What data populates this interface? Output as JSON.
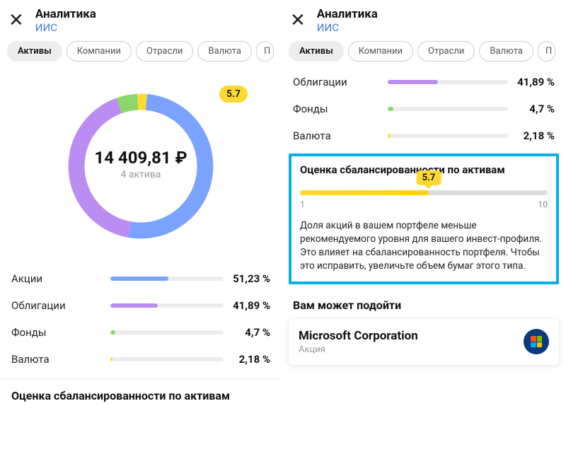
{
  "header": {
    "title": "Аналитика",
    "subtitle": "ИИС"
  },
  "tabs": [
    "Активы",
    "Компании",
    "Отрасли",
    "Валюта",
    "П"
  ],
  "active_tab": "Активы",
  "badge_score": "5.7",
  "amount": "14 409,81 ₽",
  "assets_count_label": "4 актива",
  "assets": [
    {
      "name": "Акции",
      "pct_label": "51,23 %",
      "pct": 51.23,
      "color": "#7aa2ff"
    },
    {
      "name": "Облигации",
      "pct_label": "41,89 %",
      "pct": 41.89,
      "color": "#bb8cf2"
    },
    {
      "name": "Фонды",
      "pct_label": "4,7 %",
      "pct": 4.7,
      "color": "#8ed66b"
    },
    {
      "name": "Валюта",
      "pct_label": "2,18 %",
      "pct": 2.18,
      "color": "#ffd92f"
    }
  ],
  "right_assets": [
    {
      "name": "Облигации",
      "pct_label": "41,89 %",
      "pct": 41.89,
      "color": "#bb8cf2"
    },
    {
      "name": "Фонды",
      "pct_label": "4,7 %",
      "pct": 4.7,
      "color": "#8ed66b"
    },
    {
      "name": "Валюта",
      "pct_label": "2,18 %",
      "pct": 2.18,
      "color": "#ffd92f"
    }
  ],
  "balance": {
    "section_title": "Оценка сбалансированности по активам",
    "score": "5.7",
    "score_pct": 52,
    "min_label": "1",
    "max_label": "10",
    "text": "Доля акций в вашем портфеле меньше рекомендуемого уровня для вашего инвест-профиля. Это влияет на сбалансированность портфеля. Чтобы это исправить, увеличьте объем бумаг этого типа."
  },
  "suggest": {
    "header": "Вам может подойти",
    "name": "Microsoft Corporation",
    "type": "Акция"
  },
  "chart_data": {
    "type": "pie",
    "title": "",
    "categories": [
      "Акции",
      "Облигации",
      "Фонды",
      "Валюта"
    ],
    "values": [
      51.23,
      41.89,
      4.7,
      2.18
    ],
    "colors": [
      "#7aa2ff",
      "#bb8cf2",
      "#8ed66b",
      "#ffd92f"
    ],
    "center_label": "14 409,81 ₽",
    "center_sublabel": "4 актива"
  }
}
